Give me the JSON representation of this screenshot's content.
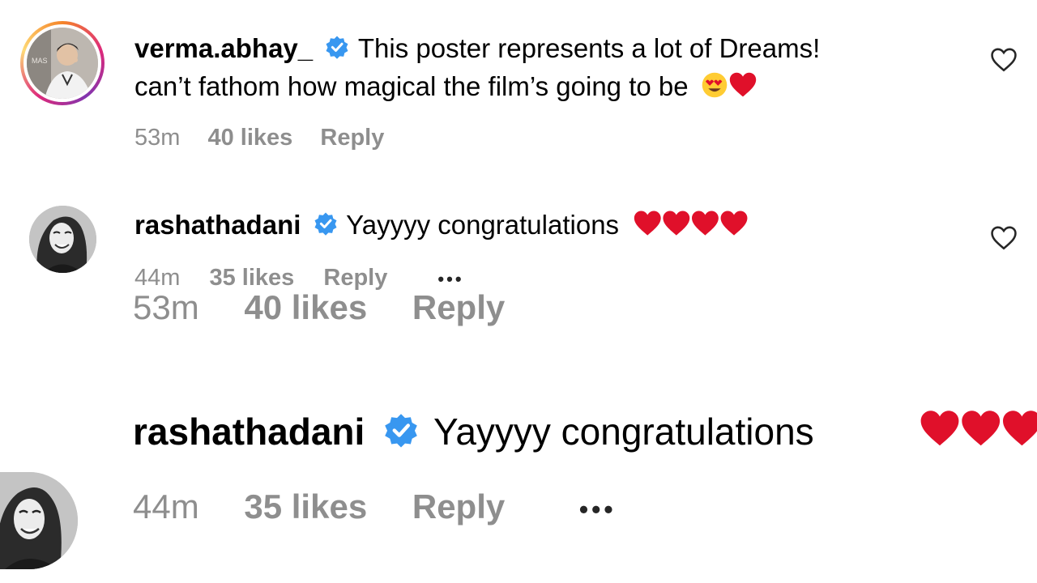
{
  "comments": [
    {
      "username": "verma.abhay_",
      "text_line1": "This poster represents a lot of Dreams!",
      "text_line2": "can’t fathom how magical the film’s going to be",
      "time": "53m",
      "likes": "40 likes",
      "reply": "Reply"
    },
    {
      "username": "rashathadani",
      "text": "Yayyyy congratulations",
      "time": "44m",
      "likes": "35 likes",
      "reply": "Reply",
      "more": "•••"
    }
  ],
  "zoomed_comment1_meta": {
    "time": "53m",
    "likes": "40 likes",
    "reply": "Reply"
  },
  "zoomed_comment2": {
    "username": "rashathadani",
    "text": "Yayyyy congratulations",
    "time": "44m",
    "likes": "35 likes",
    "reply": "Reply",
    "more": "•••"
  },
  "colors": {
    "verified": "#3897f0",
    "meta_text": "#8e8e8e",
    "heart_emoji": "#e0102a"
  },
  "icons": [
    "verified-badge-icon",
    "heart-outline-icon",
    "heart-eyes-emoji",
    "red-heart-emoji"
  ]
}
